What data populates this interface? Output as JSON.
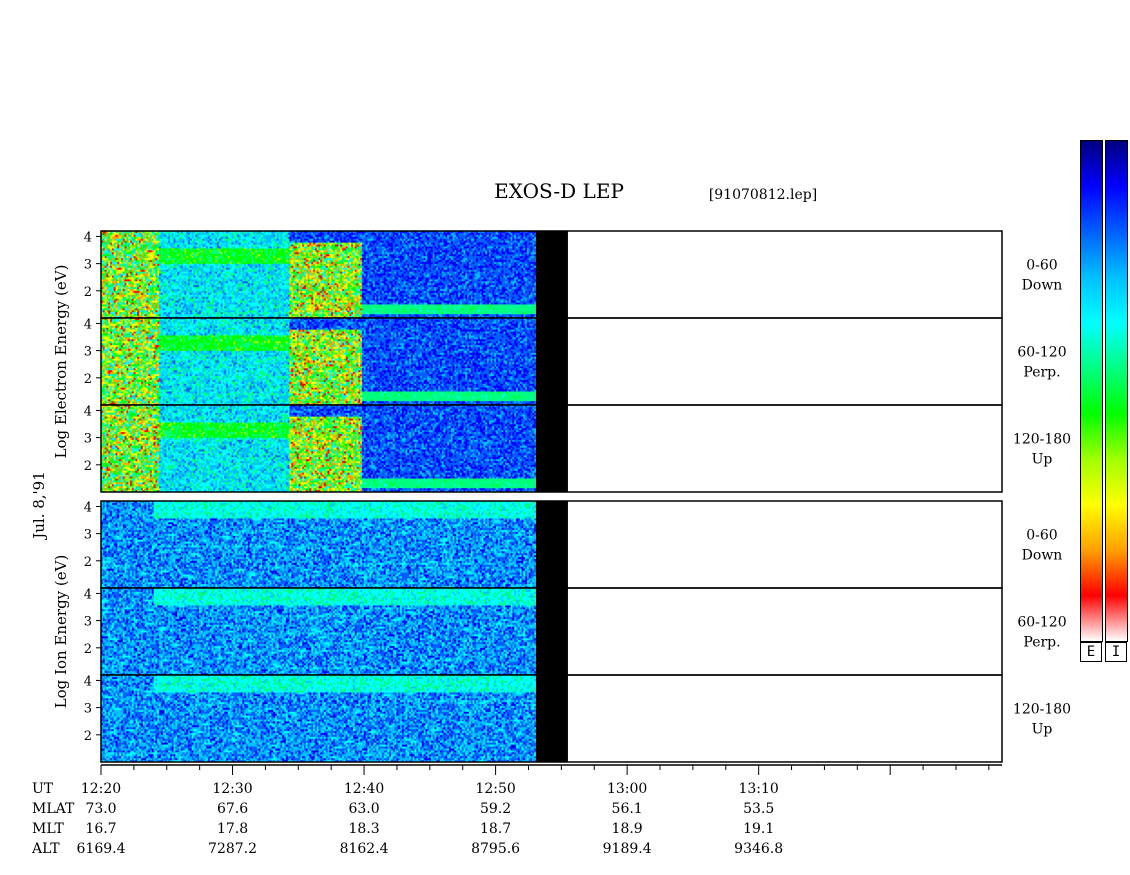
{
  "chart_data": {
    "type": "heatmap",
    "title": "EXOS-D LEP",
    "file_label": "[91070812.lep]",
    "date_label": "Jul. 8,'91",
    "colormap": [
      "#000080",
      "#0000ff",
      "#0060ff",
      "#00c0ff",
      "#00ffff",
      "#00ff80",
      "#00ff00",
      "#a0ff00",
      "#ffff00",
      "#ffa000",
      "#ff0000",
      "#ffffff"
    ],
    "colorbar_labels": [
      "E",
      "I"
    ],
    "groups": [
      {
        "name": "electron",
        "ylabel_lines": [
          "Log",
          "Electron",
          "Energy",
          "(eV)"
        ],
        "panels": [
          {
            "pitch_range": "0-60",
            "direction": "Down",
            "ylim": [
              1,
              4.2
            ],
            "yticks": [
              2,
              3,
              4
            ]
          },
          {
            "pitch_range": "60-120",
            "direction": "Perp.",
            "ylim": [
              1,
              4.2
            ],
            "yticks": [
              2,
              3,
              4
            ]
          },
          {
            "pitch_range": "120-180",
            "direction": "Up",
            "ylim": [
              1,
              4.2
            ],
            "yticks": [
              2,
              3,
              4
            ]
          }
        ]
      },
      {
        "name": "ion",
        "ylabel_lines": [
          "Log",
          "Ion",
          "Energy",
          "(eV)"
        ],
        "panels": [
          {
            "pitch_range": "0-60",
            "direction": "Down",
            "ylim": [
              1,
              4.2
            ],
            "yticks": [
              2,
              3,
              4
            ]
          },
          {
            "pitch_range": "60-120",
            "direction": "Perp.",
            "ylim": [
              1,
              4.2
            ],
            "yticks": [
              2,
              3,
              4
            ]
          },
          {
            "pitch_range": "120-180",
            "direction": "Up",
            "ylim": [
              1,
              4.2
            ],
            "yticks": [
              2,
              3,
              4
            ]
          }
        ]
      }
    ],
    "xaxis": {
      "unit": "minutes",
      "start": 740.0,
      "end": 808.5,
      "data_end": 775.5,
      "tick_labels": [
        "12:20",
        "12:30",
        "12:40",
        "12:50",
        "13:00",
        "13:10"
      ]
    },
    "ephemeris": {
      "row_labels": [
        "UT",
        "MLAT",
        "MLT",
        "ALT"
      ],
      "MLAT": [
        "73.0",
        "67.6",
        "63.0",
        "59.2",
        "56.1",
        "53.5"
      ],
      "MLT": [
        "16.7",
        "17.8",
        "18.3",
        "18.7",
        "18.9",
        "19.1"
      ],
      "ALT": [
        "6169.4",
        "7287.2",
        "8162.4",
        "8795.6",
        "9189.4",
        "9346.8"
      ]
    }
  }
}
